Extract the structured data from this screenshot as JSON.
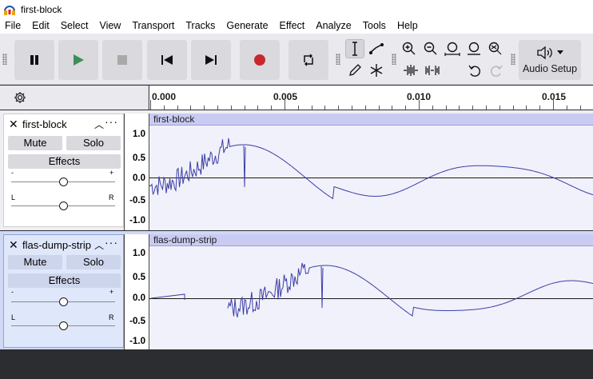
{
  "window": {
    "title": "first-block",
    "app_icon": "audacity-headphones-icon"
  },
  "menu": [
    "File",
    "Edit",
    "Select",
    "View",
    "Transport",
    "Tracks",
    "Generate",
    "Effect",
    "Analyze",
    "Tools",
    "Help"
  ],
  "toolbar": {
    "transport_icons": [
      "pause-icon",
      "play-icon",
      "stop-icon",
      "skip-to-start-icon",
      "skip-to-end-icon",
      "record-icon",
      "loop-icon"
    ],
    "tool_icons": [
      "selection-tool-icon",
      "envelope-tool-icon",
      "draw-tool-icon",
      "multi-tool-icon"
    ],
    "zoom_icons": [
      "zoom-in-icon",
      "zoom-out-icon",
      "fit-selection-icon",
      "fit-project-icon",
      "zoom-toggle-icon",
      "trim-outside-icon",
      "silence-selection-icon",
      "undo-icon",
      "redo-icon"
    ],
    "audio_setup_label": "Audio Setup",
    "colors": {
      "play": "#3e8e5a",
      "record": "#c8282c",
      "stop": "#a9a9a9"
    }
  },
  "ruler": {
    "labels": [
      "0.000",
      "0.005",
      "0.010",
      "0.015"
    ]
  },
  "tracks": [
    {
      "name": "first-block",
      "mute_label": "Mute",
      "solo_label": "Solo",
      "effects_label": "Effects",
      "gain_minus": "-",
      "gain_plus": "+",
      "pan_left": "L",
      "pan_right": "R",
      "selected": false,
      "scale": [
        "1.0",
        "0.5",
        "0.0",
        "-0.5",
        "-1.0"
      ],
      "clip_name": "first-block"
    },
    {
      "name": "flas-dump-strip",
      "mute_label": "Mute",
      "solo_label": "Solo",
      "effects_label": "Effects",
      "gain_minus": "-",
      "gain_plus": "+",
      "pan_left": "L",
      "pan_right": "R",
      "selected": true,
      "scale": [
        "1.0",
        "0.5",
        "0.0",
        "-0.5",
        "-1.0"
      ],
      "clip_name": "flas-dump-strip"
    }
  ],
  "colors": {
    "waveform": "#3c3ea6",
    "clip_header": "#c9cbf2",
    "wave_bg": "#f1f1fb",
    "selected_track": "#dfe7fb"
  }
}
